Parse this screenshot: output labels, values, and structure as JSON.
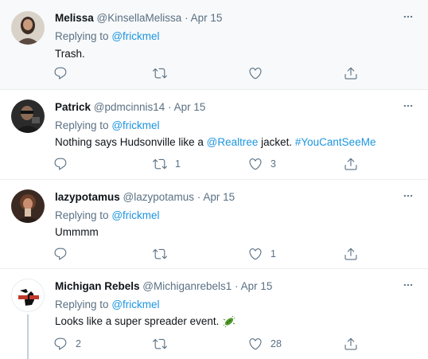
{
  "replying_prefix": "Replying to",
  "replying_handle": "@frickmel",
  "tweets": [
    {
      "name": "Melissa",
      "handle": "@KinsellaMelissa",
      "sep": "·",
      "date": "Apr 15",
      "text": "Trash.",
      "replies": "",
      "retweets": "",
      "likes": ""
    },
    {
      "name": "Patrick",
      "handle": "@pdmcinnis14",
      "sep": "·",
      "date": "Apr 15",
      "text_before": "Nothing says Hudsonville like a ",
      "mention": "@Realtree",
      "text_middle": " jacket. ",
      "hashtag": "#YouCantSeeMe",
      "replies": "",
      "retweets": "1",
      "likes": "3"
    },
    {
      "name": "lazypotamus",
      "handle": "@lazypotamus",
      "sep": "·",
      "date": "Apr 15",
      "text": "Ummmm",
      "replies": "",
      "retweets": "",
      "likes": "1"
    },
    {
      "name": "Michigan Rebels",
      "handle": "@Michiganrebels1",
      "sep": "·",
      "date": "Apr 15",
      "text": "Looks like a super spreader event.",
      "emoji_icon": "microbe-icon",
      "replies": "2",
      "retweets": "",
      "likes": "28"
    }
  ],
  "colors": {
    "muted": "#5b7083",
    "link": "#1b95e0",
    "text": "#0f1419",
    "highlight_bg": "#f7f9fa",
    "border": "#ebeef0"
  }
}
